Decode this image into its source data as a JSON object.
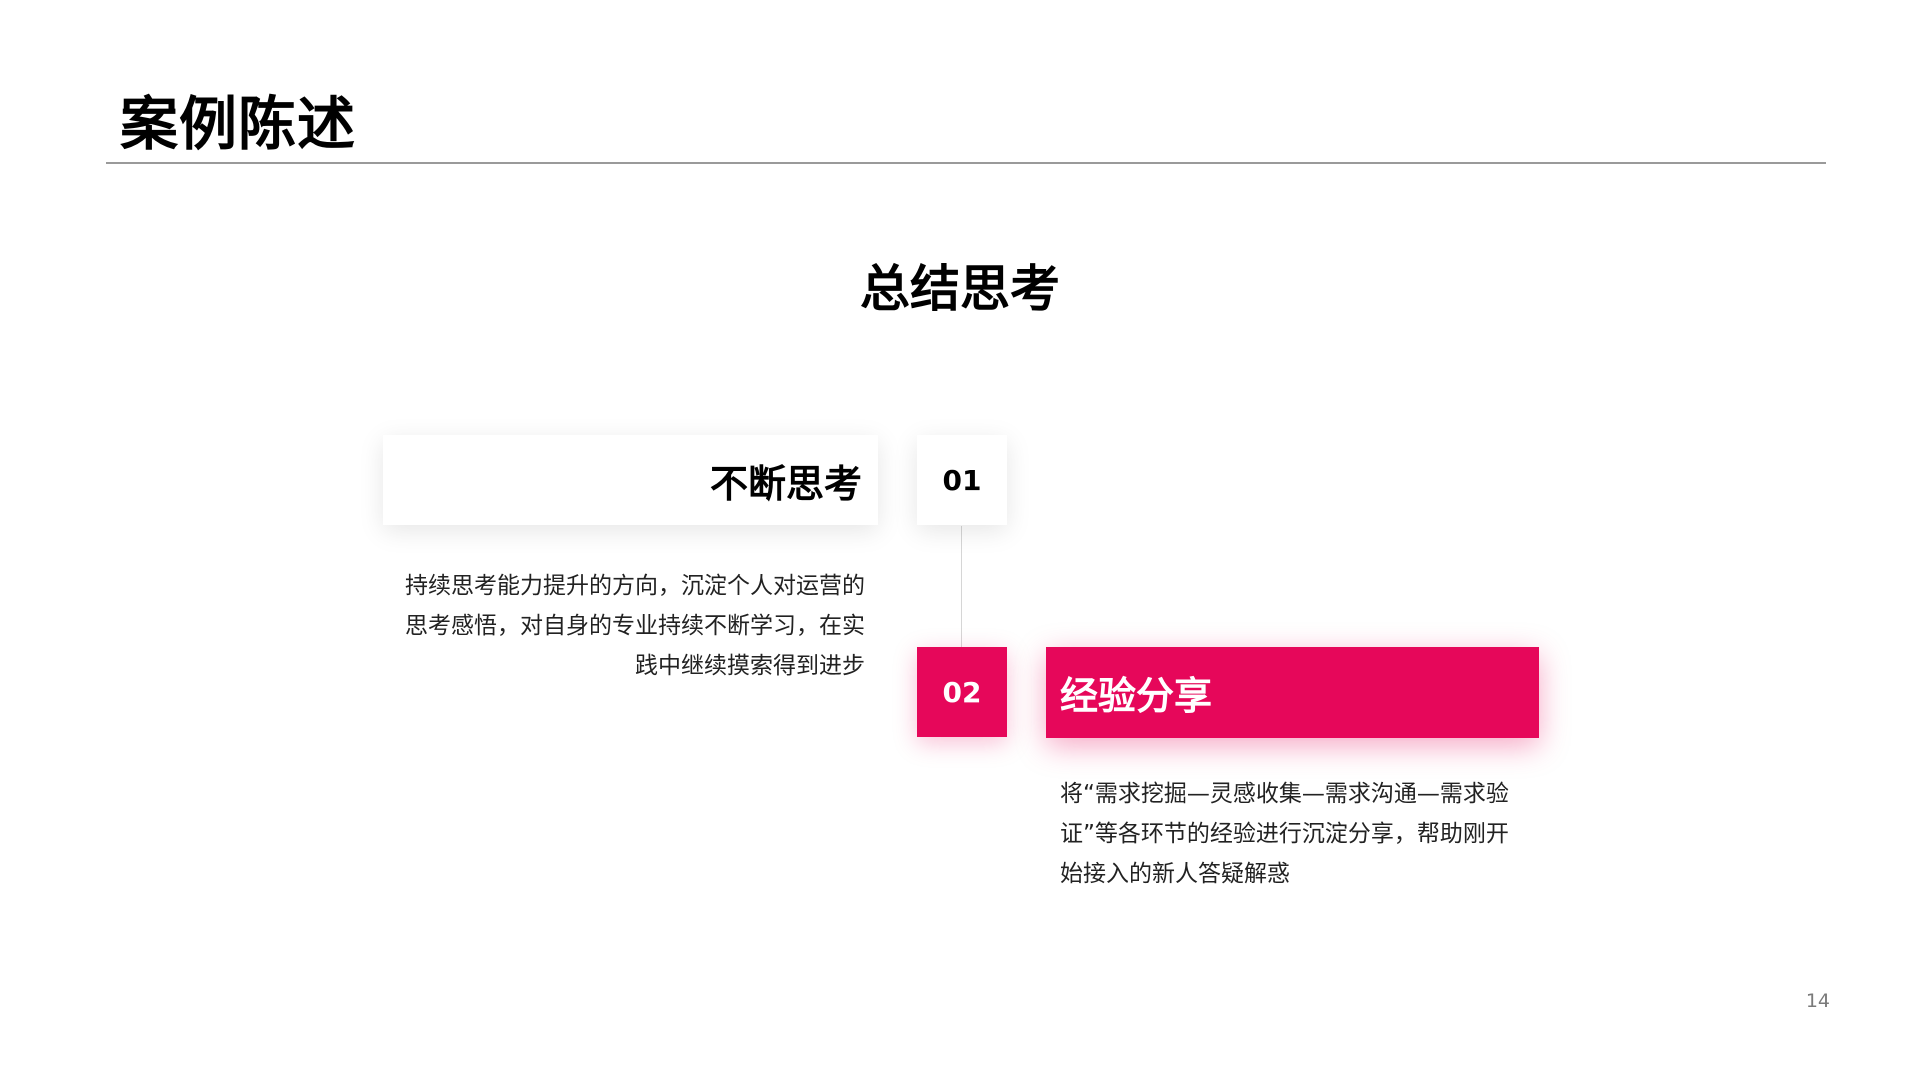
{
  "header": {
    "title": "案例陈述"
  },
  "main": {
    "heading": "总结思考",
    "items": [
      {
        "number": "01",
        "title": "不断思考",
        "description": "持续思考能力提升的方向，沉淀个人对运营的思考感悟，对自身的专业持续不断学习，在实践中继续摸索得到进步"
      },
      {
        "number": "02",
        "title": "经验分享",
        "description": "将“需求挖掘—灵感收集—需求沟通—需求验证”等各环节的经验进行沉淀分享，帮助刚开始接入的新人答疑解惑"
      }
    ]
  },
  "footer": {
    "page_number": "14"
  },
  "colors": {
    "accent": "#e6075a",
    "rule": "#9a9a9a",
    "background": "#ffffff",
    "text": "#000000"
  }
}
